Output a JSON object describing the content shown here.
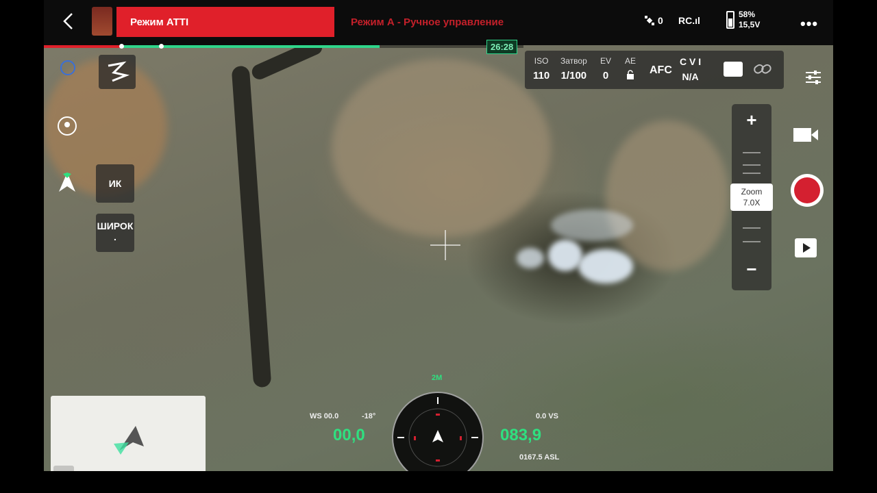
{
  "topbar": {
    "mode_label": "Режим ATTI",
    "mode_subtitle": "Режим А - Ручное управление",
    "gps_count": "0",
    "rc_label": "RC.ıl",
    "battery_percent": "58%",
    "battery_voltage": "15,5V"
  },
  "recording": {
    "time": "26:28",
    "progress_fraction": 0.7
  },
  "camera_params": {
    "iso_label": "ISO",
    "iso_value": "110",
    "shutter_label": "Затвор",
    "shutter_value": "1/100",
    "ev_label": "EV",
    "ev_value": "0",
    "ae_label": "AE",
    "focus_mode": "AFC",
    "color_label": "C V I",
    "color_value": "N/A"
  },
  "left_controls": {
    "ik_label": "ИК",
    "wide_label": "ШИРОК",
    "wide_sub": "."
  },
  "zoom": {
    "label": "Zoom",
    "value": "7.0X"
  },
  "telemetry": {
    "ws_label": "WS 00.0",
    "pitch": "-18°",
    "hs_value": "00,0",
    "vs_label": "0.0 VS",
    "height_value": "083,9",
    "asl_label": "0167.5 ASL",
    "compass_label": "2M"
  },
  "colors": {
    "mode_red": "#e0202a",
    "telemetry_green": "#2fe080",
    "progress_green": "#2fd58a"
  },
  "icons": [
    "back-icon",
    "satellite-icon",
    "battery-icon",
    "more-icon",
    "camera-switch-icon",
    "link-icon",
    "settings-icon",
    "video-icon",
    "shutter-icon",
    "playback-icon",
    "gimbal-icon",
    "home-icon",
    "lock-icon",
    "aircraft-icon",
    "expand-icon"
  ]
}
